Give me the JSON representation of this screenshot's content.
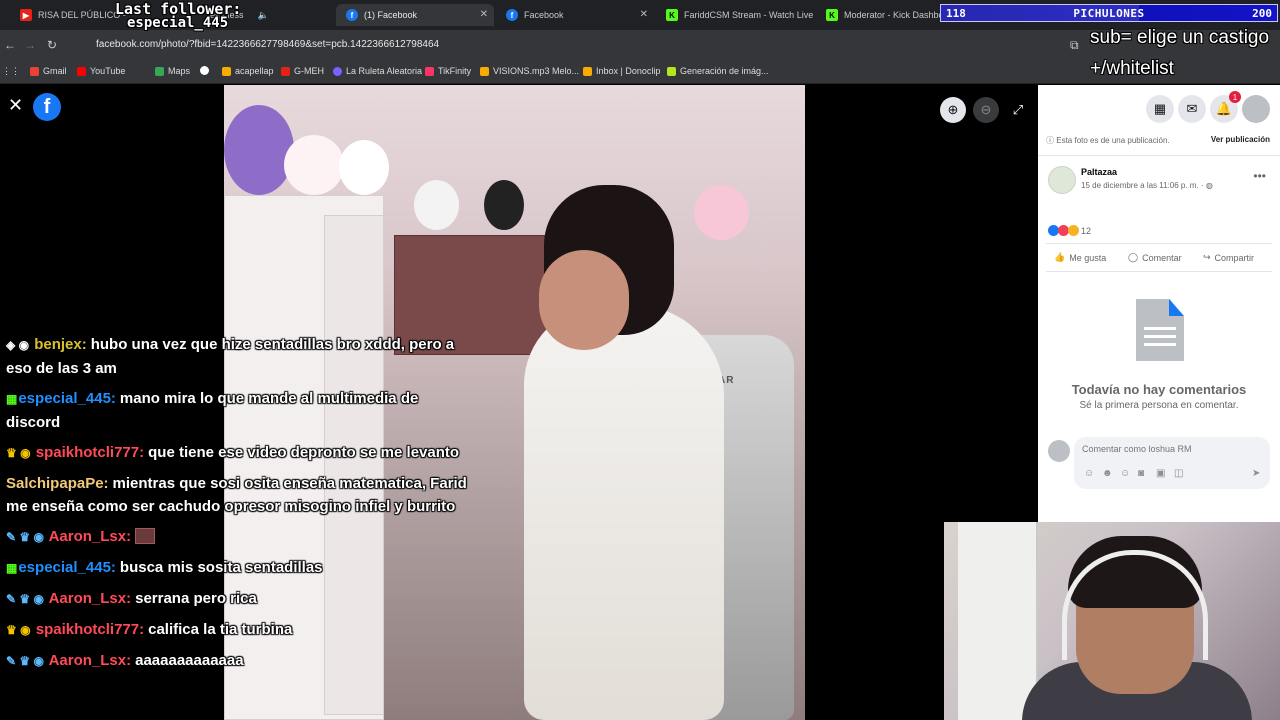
{
  "browser": {
    "tabs": [
      {
        "title": "RISA DEL PÚBLICO - ",
        "color": "#e62117",
        "icon": "youtube-icon"
      },
      {
        "title": "es · less",
        "color": "#888888",
        "icon": "audio-icon"
      },
      {
        "title": "(1) Facebook",
        "color": "#1877f2",
        "icon": "facebook-icon",
        "active": true
      },
      {
        "title": "Facebook",
        "color": "#1877f2",
        "icon": "facebook-icon"
      },
      {
        "title": "FariddCSM Stream - Watch Live",
        "color": "#53fc18",
        "icon": "kick-icon"
      },
      {
        "title": "Moderator - Kick Dashboard",
        "color": "#53fc18",
        "icon": "kick-icon"
      }
    ],
    "url": "facebook.com/photo/?fbid=1422366627798469&set=pcb.1422366612798464",
    "bookmarks": [
      {
        "label": "Gmail",
        "color": "#ea4335"
      },
      {
        "label": "YouTube",
        "color": "#ff0000"
      },
      {
        "label": "Maps",
        "color": "#34a853"
      },
      {
        "label": "",
        "color": "#ffffff"
      },
      {
        "label": "acapellap",
        "color": "#f9ab00"
      },
      {
        "label": "G-MEH",
        "color": "#e62117"
      },
      {
        "label": "La Ruleta Aleatoria",
        "color": "#7b61ff"
      },
      {
        "label": "TikFinity",
        "color": "#ff3366"
      },
      {
        "label": "VISIONS.mp3 Melo...",
        "color": "#f9ab00"
      },
      {
        "label": "Inbox | Donoclip",
        "color": "#f9ab00"
      },
      {
        "label": "Generación de imág...",
        "color": "#b5e61d"
      }
    ]
  },
  "facebook": {
    "notice": "Esta foto es de una publicación.",
    "see_post": "Ver publicación",
    "page_name": "Paltazaa",
    "post_date": "15 de diciembre a las 11:06 p. m. ·",
    "reaction_count": "12",
    "actions": {
      "like": "Me gusta",
      "comment": "Comentar",
      "share": "Compartir"
    },
    "no_comments": "Todavía no hay comentarios",
    "be_first": "Sé la primera persona en comentar.",
    "comment_placeholder": "Comentar como loshua RM",
    "notification_count": "1",
    "photo_chair_brand": "COUGAR"
  },
  "stream": {
    "follower_line1": "Last follower:",
    "follower_line2": "especial_445",
    "counter_left": "118",
    "counter_title": "PICHULONES",
    "counter_right": "200",
    "counter_progress": 0.59,
    "sub_line1": "sub= elige un castigo",
    "sub_line2": "+/whitelist"
  },
  "chat": [
    {
      "badges": "◈ ◉",
      "user": "benjex:",
      "user_color": "#d8c02b",
      "text": "hubo una vez que hize sentadillas bro xddd, pero a eso de las 3 am"
    },
    {
      "badges": "▦",
      "user": "especial_445:",
      "user_color": "#1e90ff",
      "text": "mano mira lo que mande al multimedia de discord"
    },
    {
      "badges": "♛ ◉",
      "user": "spaikhotcli777:",
      "user_color": "#ff4a57",
      "text": "que tiene ese video depronto se me levanto"
    },
    {
      "badges": "",
      "user": "SalchipapaPe:",
      "user_color": "#f2c879",
      "text": "mientras que sosi osita enseña matematica, Farid me enseña como ser cachudo opresor misogino infiel y burrito"
    },
    {
      "badges": "✎ ♛ ◉",
      "user": "Aaron_Lsx:",
      "user_color": "#ff4a57",
      "text": "",
      "emote": true
    },
    {
      "badges": "▦",
      "user": "especial_445:",
      "user_color": "#1e90ff",
      "text": "busca mis sosita sentadillas"
    },
    {
      "badges": "✎ ♛ ◉",
      "user": "Aaron_Lsx:",
      "user_color": "#ff4a57",
      "text": "serrana pero rica"
    },
    {
      "badges": "♛ ◉",
      "user": "spaikhotcli777:",
      "user_color": "#ff4a57",
      "text": "califica la tia turbina"
    },
    {
      "badges": "✎ ♛ ◉",
      "user": "Aaron_Lsx:",
      "user_color": "#ff4a57",
      "text": "aaaaaaaaaaaaa"
    }
  ]
}
